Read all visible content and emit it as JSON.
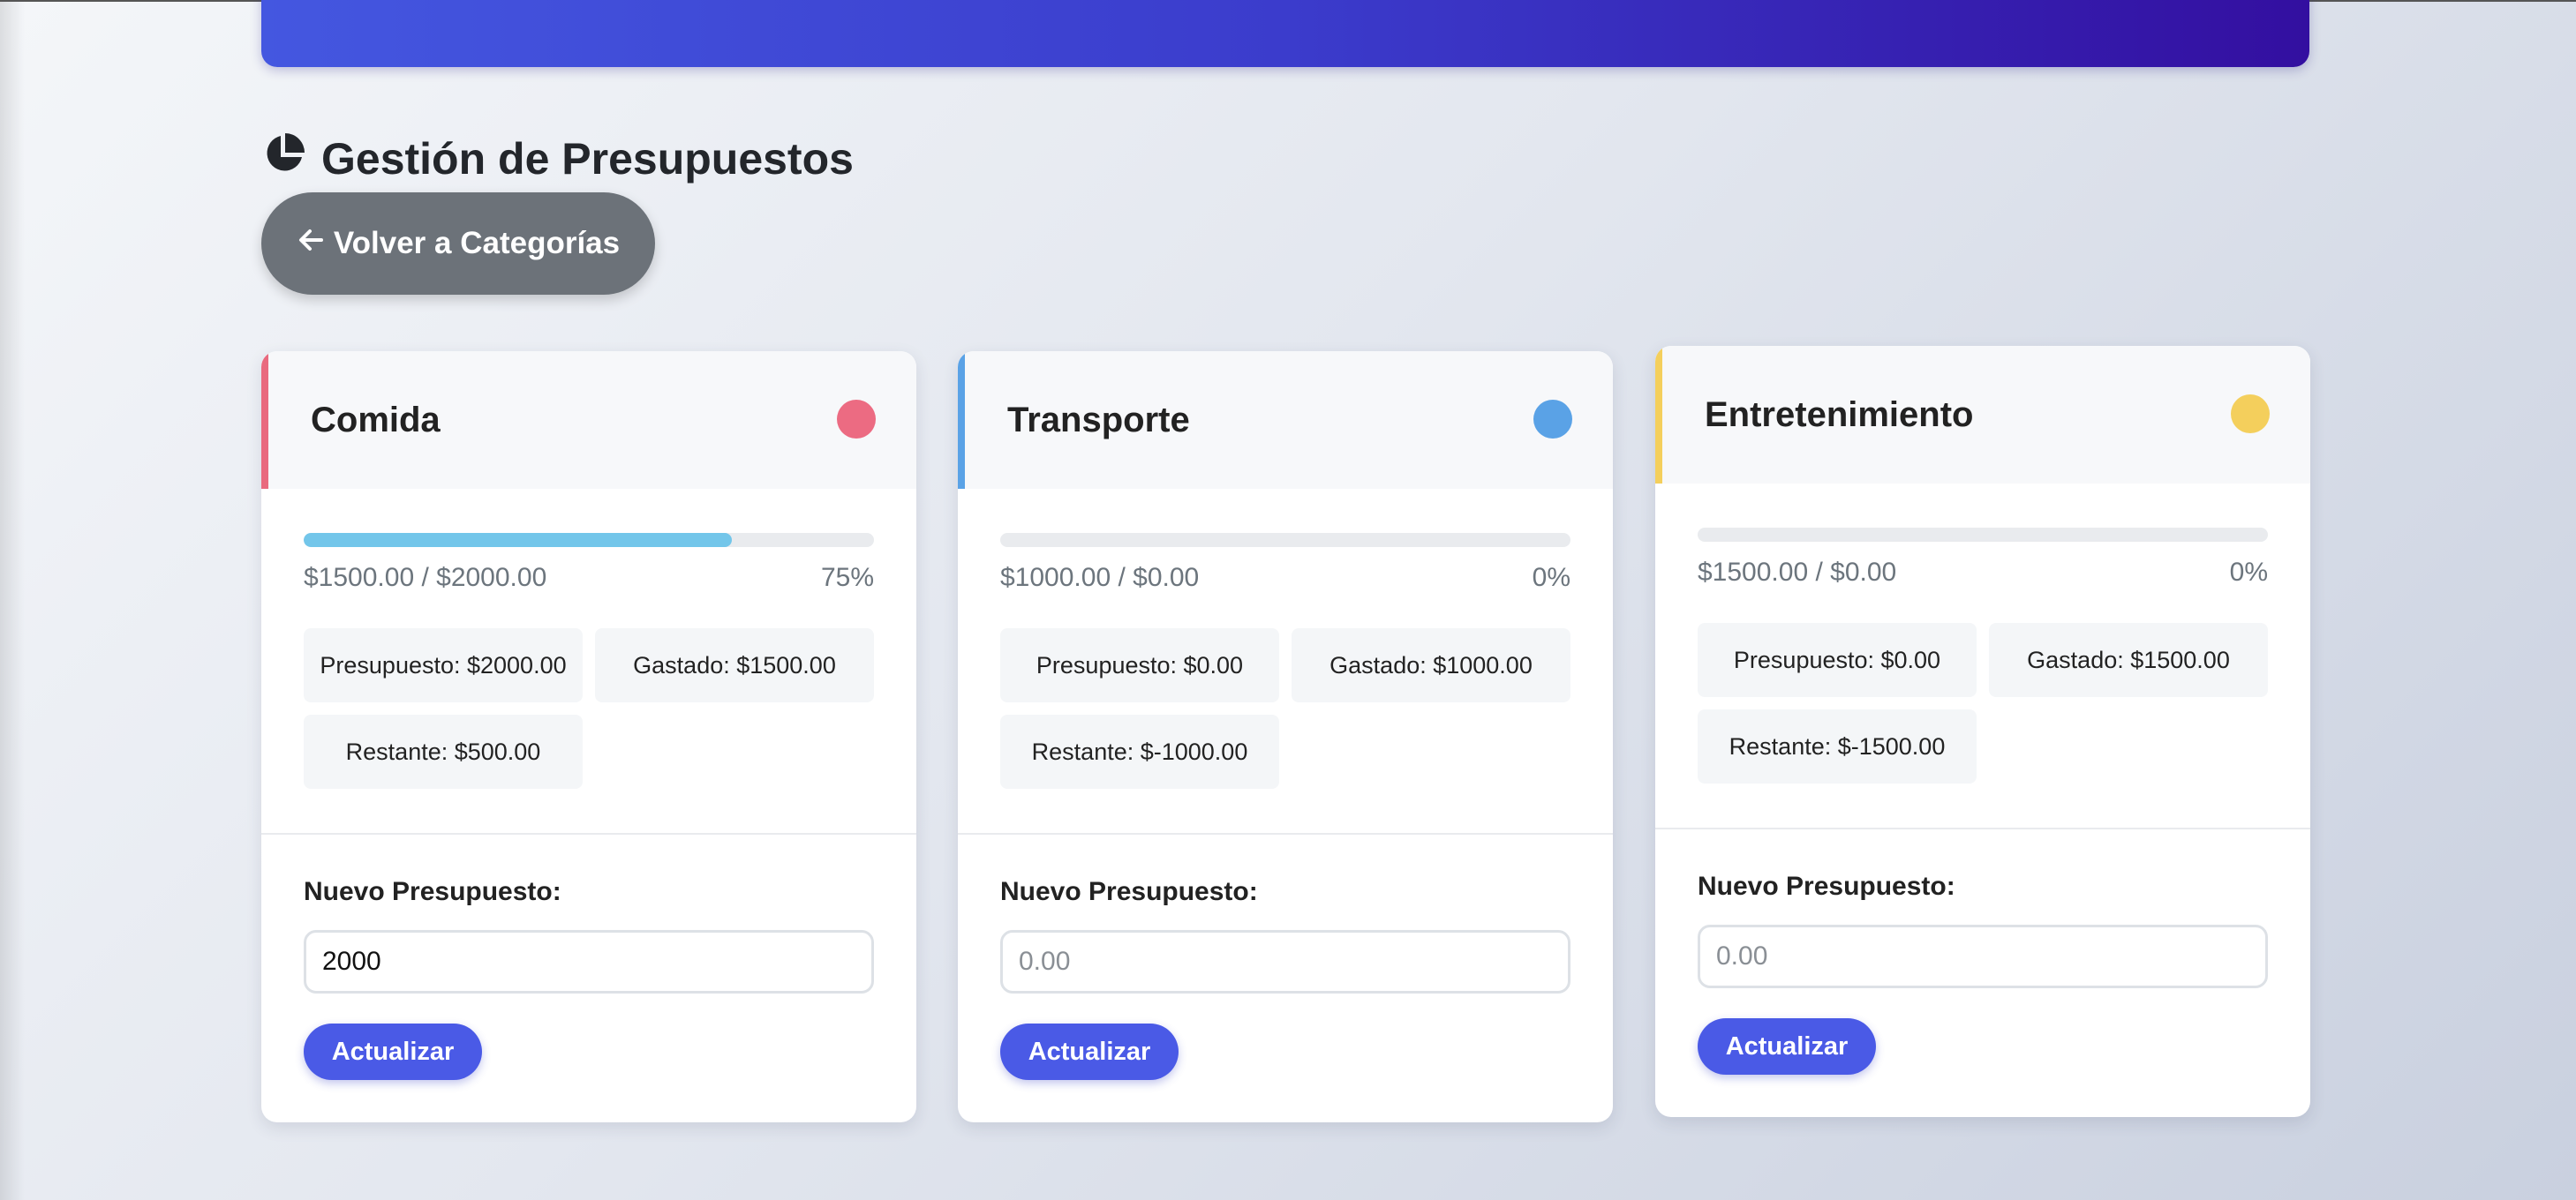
{
  "page": {
    "title": "Gestión de Presupuestos",
    "title_icon": "pie-chart-icon",
    "back_button": {
      "label": "Volver a Categorías",
      "icon": "arrow-left-icon"
    }
  },
  "cards": [
    {
      "name": "Comida",
      "color": "#e96a7e",
      "dot_color": "#ec6b82",
      "progress_percent": 75,
      "amounts": "$1500.00 / $2000.00",
      "percent_label": "75%",
      "presupuesto": "Presupuesto: $2000.00",
      "gastado": "Gastado: $1500.00",
      "restante": "Restante: $500.00",
      "new_budget_label": "Nuevo Presupuesto:",
      "input_value": "2000",
      "input_placeholder": "0.00",
      "button_label": "Actualizar"
    },
    {
      "name": "Transporte",
      "color": "#5aa2e6",
      "dot_color": "#5aa2e6",
      "progress_percent": 0,
      "amounts": "$1000.00 / $0.00",
      "percent_label": "0%",
      "presupuesto": "Presupuesto: $0.00",
      "gastado": "Gastado: $1000.00",
      "restante": "Restante: $-1000.00",
      "new_budget_label": "Nuevo Presupuesto:",
      "input_value": "",
      "input_placeholder": "0.00",
      "button_label": "Actualizar"
    },
    {
      "name": "Entretenimiento",
      "color": "#f4cf5c",
      "dot_color": "#f4cf5c",
      "progress_percent": 0,
      "amounts": "$1500.00 / $0.00",
      "percent_label": "0%",
      "presupuesto": "Presupuesto: $0.00",
      "gastado": "Gastado: $1500.00",
      "restante": "Restante: $-1500.00",
      "new_budget_label": "Nuevo Presupuesto:",
      "input_value": "",
      "input_placeholder": "0.00",
      "button_label": "Actualizar"
    }
  ],
  "colors": {
    "hero_start": "#4457e0",
    "hero_end": "#330fa0",
    "accent_button": "#4a5ae6",
    "back_button": "#6c7279"
  }
}
